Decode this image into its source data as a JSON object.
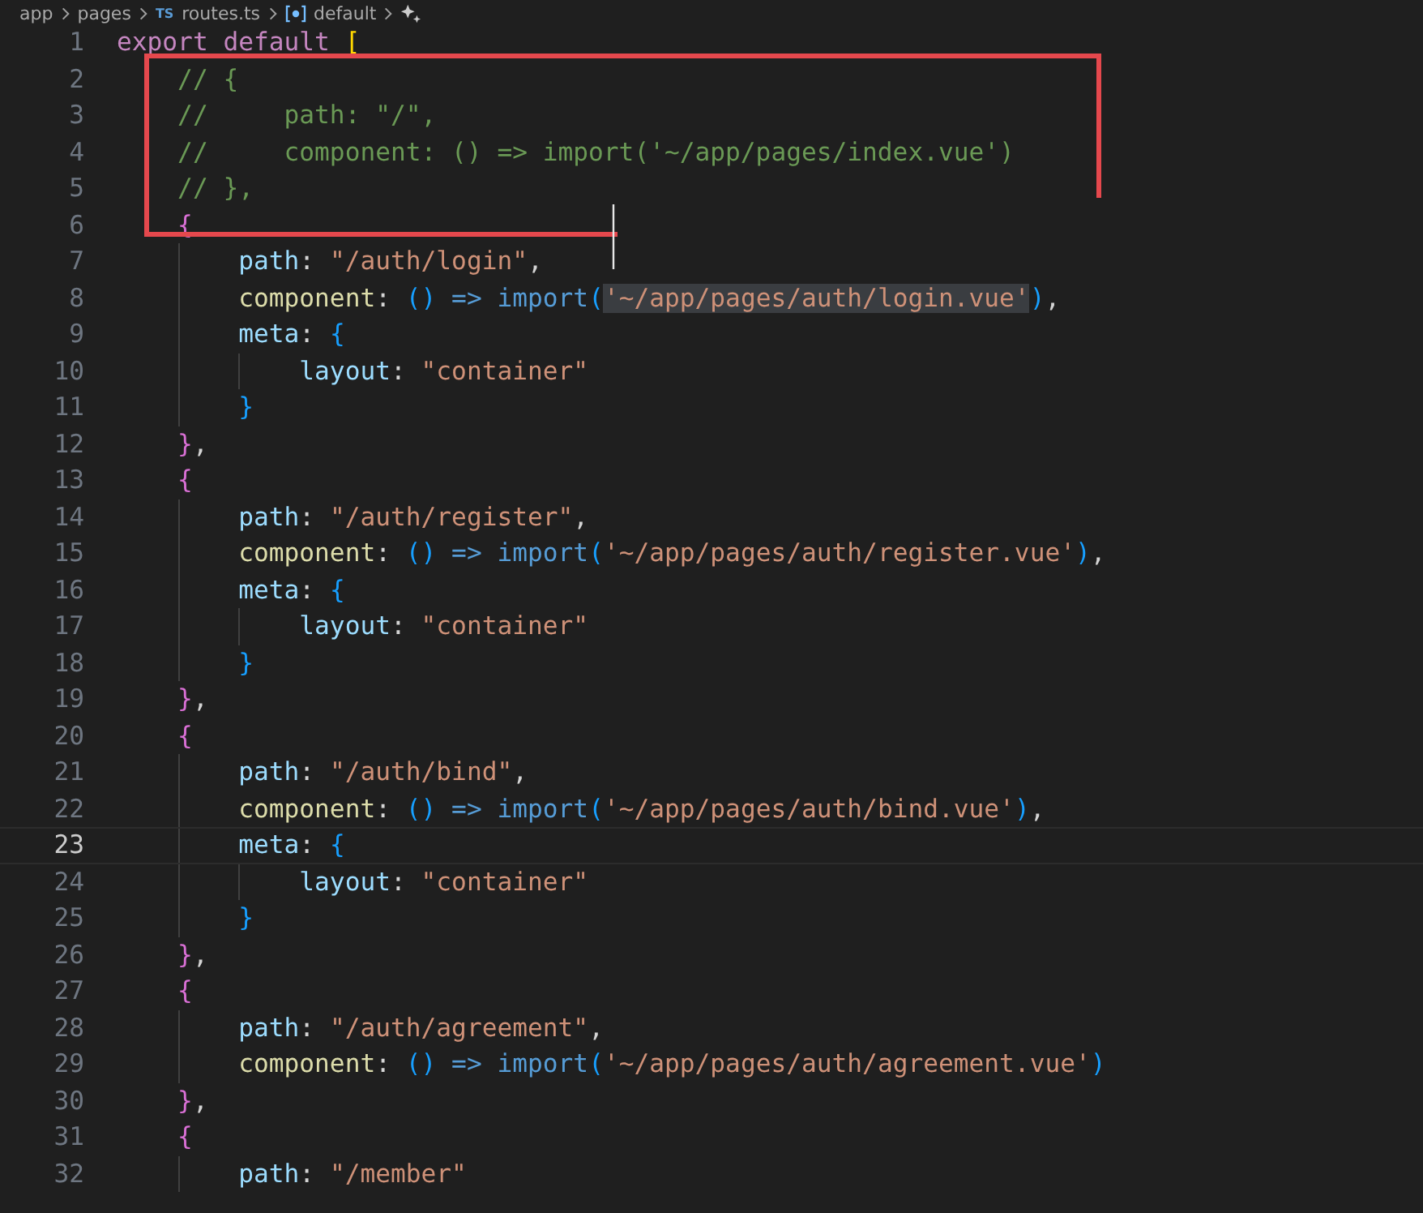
{
  "breadcrumb": [
    {
      "label": "app",
      "kind": "folder"
    },
    {
      "label": "pages",
      "kind": "folder"
    },
    {
      "label": "routes.ts",
      "kind": "file",
      "badge": "TS"
    },
    {
      "label": "default",
      "kind": "symbol"
    },
    {
      "kind": "sparkle"
    }
  ],
  "lines": [
    {
      "number": "1",
      "current": false,
      "tokens": [
        {
          "kind": "keyword",
          "text": "export default "
        },
        {
          "kind": "bracket-gold",
          "text": "["
        }
      ]
    },
    {
      "number": "2",
      "current": false,
      "tokens": [
        {
          "kind": "comment",
          "text": "    // {"
        }
      ]
    },
    {
      "number": "3",
      "current": false,
      "tokens": [
        {
          "kind": "comment",
          "text": "    //     path: \"/\","
        }
      ]
    },
    {
      "number": "4",
      "current": false,
      "tokens": [
        {
          "kind": "comment",
          "text": "    //     component: () => import('~/app/pages/index.vue')"
        }
      ]
    },
    {
      "number": "5",
      "current": false,
      "tokens": [
        {
          "kind": "comment",
          "text": "    // },"
        }
      ]
    },
    {
      "number": "6",
      "current": false,
      "tokens": [
        {
          "kind": "bracket-pink",
          "text": "    {"
        }
      ]
    },
    {
      "number": "7",
      "current": false,
      "tokens": [
        {
          "kind": "property",
          "text": "        path"
        },
        {
          "kind": "punct",
          "text": ": "
        },
        {
          "kind": "string",
          "text": "\"/auth/login\""
        },
        {
          "kind": "punct",
          "text": ","
        }
      ]
    },
    {
      "number": "8",
      "current": false,
      "tokens": [
        {
          "kind": "function",
          "text": "        component"
        },
        {
          "kind": "punct",
          "text": ": "
        },
        {
          "kind": "bracket-blue",
          "text": "()"
        },
        {
          "kind": "operator",
          "text": " => import"
        },
        {
          "kind": "bracket-blue",
          "text": "("
        },
        {
          "kind": "string",
          "text": "'~/app/pages/auth/login.vue'",
          "highlighted": true
        },
        {
          "kind": "bracket-blue",
          "text": ")"
        },
        {
          "kind": "punct",
          "text": ","
        }
      ]
    },
    {
      "number": "9",
      "current": false,
      "tokens": [
        {
          "kind": "property",
          "text": "        meta"
        },
        {
          "kind": "punct",
          "text": ": "
        },
        {
          "kind": "bracket-blue",
          "text": "{"
        }
      ]
    },
    {
      "number": "10",
      "current": false,
      "tokens": [
        {
          "kind": "property",
          "text": "            layout"
        },
        {
          "kind": "punct",
          "text": ": "
        },
        {
          "kind": "string",
          "text": "\"container\""
        }
      ]
    },
    {
      "number": "11",
      "current": false,
      "tokens": [
        {
          "kind": "bracket-blue",
          "text": "        }"
        }
      ]
    },
    {
      "number": "12",
      "current": false,
      "tokens": [
        {
          "kind": "bracket-pink",
          "text": "    }"
        },
        {
          "kind": "punct",
          "text": ","
        }
      ]
    },
    {
      "number": "13",
      "current": false,
      "tokens": [
        {
          "kind": "bracket-pink",
          "text": "    {"
        }
      ]
    },
    {
      "number": "14",
      "current": false,
      "tokens": [
        {
          "kind": "property",
          "text": "        path"
        },
        {
          "kind": "punct",
          "text": ": "
        },
        {
          "kind": "string",
          "text": "\"/auth/register\""
        },
        {
          "kind": "punct",
          "text": ","
        }
      ]
    },
    {
      "number": "15",
      "current": false,
      "tokens": [
        {
          "kind": "function",
          "text": "        component"
        },
        {
          "kind": "punct",
          "text": ": "
        },
        {
          "kind": "bracket-blue",
          "text": "()"
        },
        {
          "kind": "operator",
          "text": " => import"
        },
        {
          "kind": "bracket-blue",
          "text": "("
        },
        {
          "kind": "string",
          "text": "'~/app/pages/auth/register.vue'"
        },
        {
          "kind": "bracket-blue",
          "text": ")"
        },
        {
          "kind": "punct",
          "text": ","
        }
      ]
    },
    {
      "number": "16",
      "current": false,
      "tokens": [
        {
          "kind": "property",
          "text": "        meta"
        },
        {
          "kind": "punct",
          "text": ": "
        },
        {
          "kind": "bracket-blue",
          "text": "{"
        }
      ]
    },
    {
      "number": "17",
      "current": false,
      "tokens": [
        {
          "kind": "property",
          "text": "            layout"
        },
        {
          "kind": "punct",
          "text": ": "
        },
        {
          "kind": "string",
          "text": "\"container\""
        }
      ]
    },
    {
      "number": "18",
      "current": false,
      "tokens": [
        {
          "kind": "bracket-blue",
          "text": "        }"
        }
      ]
    },
    {
      "number": "19",
      "current": false,
      "tokens": [
        {
          "kind": "bracket-pink",
          "text": "    }"
        },
        {
          "kind": "punct",
          "text": ","
        }
      ]
    },
    {
      "number": "20",
      "current": false,
      "tokens": [
        {
          "kind": "bracket-pink",
          "text": "    {"
        }
      ]
    },
    {
      "number": "21",
      "current": false,
      "tokens": [
        {
          "kind": "property",
          "text": "        path"
        },
        {
          "kind": "punct",
          "text": ": "
        },
        {
          "kind": "string",
          "text": "\"/auth/bind\""
        },
        {
          "kind": "punct",
          "text": ","
        }
      ]
    },
    {
      "number": "22",
      "current": false,
      "tokens": [
        {
          "kind": "function",
          "text": "        component"
        },
        {
          "kind": "punct",
          "text": ": "
        },
        {
          "kind": "bracket-blue",
          "text": "()"
        },
        {
          "kind": "operator",
          "text": " => import"
        },
        {
          "kind": "bracket-blue",
          "text": "("
        },
        {
          "kind": "string",
          "text": "'~/app/pages/auth/bind.vue'"
        },
        {
          "kind": "bracket-blue",
          "text": ")"
        },
        {
          "kind": "punct",
          "text": ","
        }
      ]
    },
    {
      "number": "23",
      "current": true,
      "tokens": [
        {
          "kind": "property",
          "text": "        meta"
        },
        {
          "kind": "punct",
          "text": ": "
        },
        {
          "kind": "bracket-blue",
          "text": "{"
        }
      ]
    },
    {
      "number": "24",
      "current": false,
      "tokens": [
        {
          "kind": "property",
          "text": "            layout"
        },
        {
          "kind": "punct",
          "text": ": "
        },
        {
          "kind": "string",
          "text": "\"container\""
        }
      ]
    },
    {
      "number": "25",
      "current": false,
      "tokens": [
        {
          "kind": "bracket-blue",
          "text": "        }"
        }
      ]
    },
    {
      "number": "26",
      "current": false,
      "tokens": [
        {
          "kind": "bracket-pink",
          "text": "    }"
        },
        {
          "kind": "punct",
          "text": ","
        }
      ]
    },
    {
      "number": "27",
      "current": false,
      "tokens": [
        {
          "kind": "bracket-pink",
          "text": "    {"
        }
      ]
    },
    {
      "number": "28",
      "current": false,
      "tokens": [
        {
          "kind": "property",
          "text": "        path"
        },
        {
          "kind": "punct",
          "text": ": "
        },
        {
          "kind": "string",
          "text": "\"/auth/agreement\""
        },
        {
          "kind": "punct",
          "text": ","
        }
      ]
    },
    {
      "number": "29",
      "current": false,
      "tokens": [
        {
          "kind": "function",
          "text": "        component"
        },
        {
          "kind": "punct",
          "text": ": "
        },
        {
          "kind": "bracket-blue",
          "text": "()"
        },
        {
          "kind": "operator",
          "text": " => import"
        },
        {
          "kind": "bracket-blue",
          "text": "("
        },
        {
          "kind": "string",
          "text": "'~/app/pages/auth/agreement.vue'"
        },
        {
          "kind": "bracket-blue",
          "text": ")"
        }
      ]
    },
    {
      "number": "30",
      "current": false,
      "tokens": [
        {
          "kind": "bracket-pink",
          "text": "    }"
        },
        {
          "kind": "punct",
          "text": ","
        }
      ]
    },
    {
      "number": "31",
      "current": false,
      "tokens": [
        {
          "kind": "bracket-pink",
          "text": "    {"
        }
      ]
    },
    {
      "number": "32",
      "current": false,
      "tokens": [
        {
          "kind": "property",
          "text": "        path"
        },
        {
          "kind": "punct",
          "text": ": "
        },
        {
          "kind": "string",
          "text": "\"/member\""
        }
      ]
    }
  ]
}
